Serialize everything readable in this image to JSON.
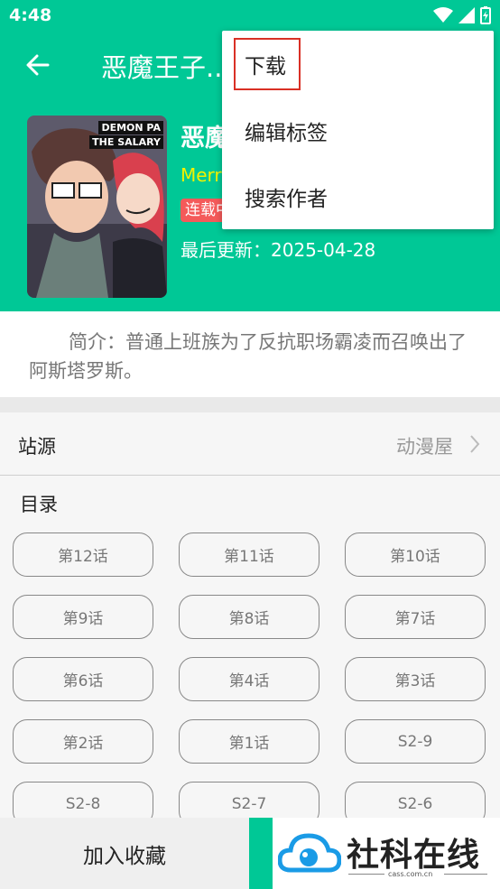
{
  "status_bar": {
    "time": "4:48"
  },
  "toolbar": {
    "title": "恶魔王子..."
  },
  "comic": {
    "cover_text_line1": "DEMON PA",
    "cover_text_line2": "THE SALARY",
    "title": "恶魔",
    "author": "Merry",
    "status": "连载中",
    "last_update": "最后更新：2025-04-28",
    "intro": "简介：普通上班族为了反抗职场霸凌而召唤出了阿斯塔罗斯。"
  },
  "source": {
    "label": "站源",
    "value": "动漫屋"
  },
  "catalog": {
    "label": "目录",
    "chapters": [
      "第12话",
      "第11话",
      "第10话",
      "第9话",
      "第8话",
      "第7话",
      "第6话",
      "第4话",
      "第3话",
      "第2话",
      "第1话",
      "S2-9",
      "S2-8",
      "S2-7",
      "S2-6"
    ]
  },
  "bottom": {
    "favorite_label": "加入收藏"
  },
  "menu": {
    "items": [
      {
        "label": "下载"
      },
      {
        "label": "编辑标签"
      },
      {
        "label": "搜索作者"
      }
    ]
  },
  "watermark": {
    "text": "社科在线",
    "url": "cass.com.cn"
  },
  "colors": {
    "accent": "#00c896",
    "badge": "#f45a5a",
    "author": "#f2f200",
    "highlight": "#d93025"
  }
}
